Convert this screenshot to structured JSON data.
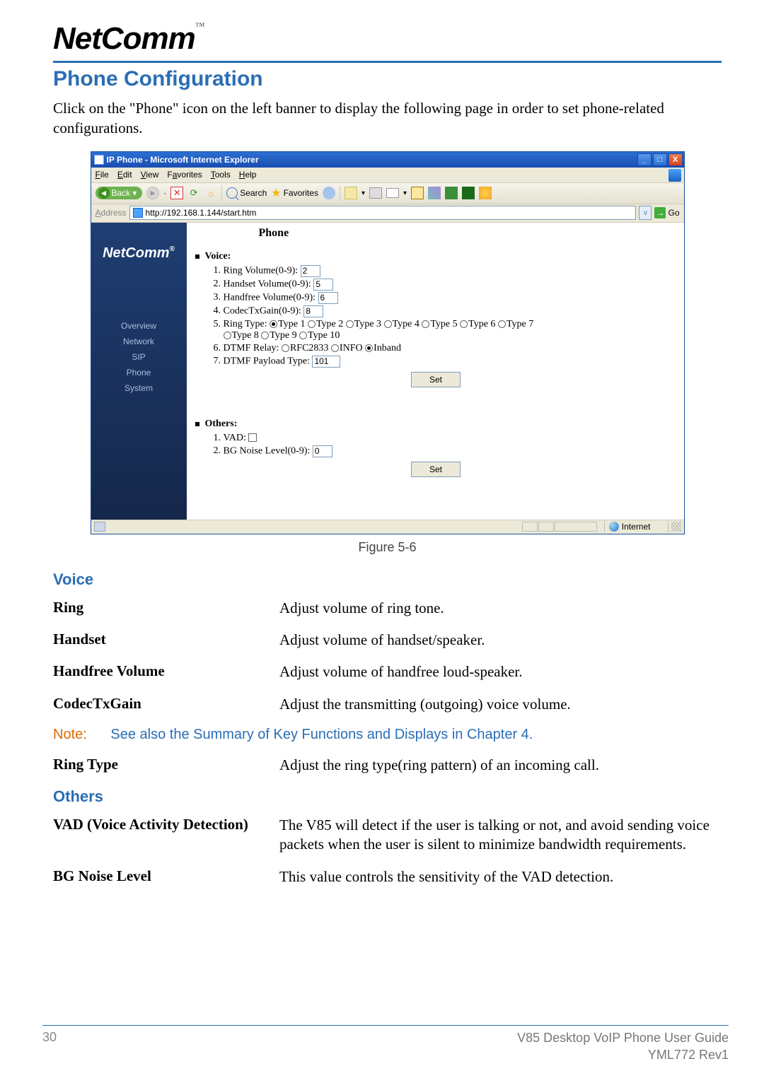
{
  "brand": {
    "name": "NetComm",
    "tm": "™",
    "reg": "®"
  },
  "headings": {
    "section": "Phone Configuration",
    "voice": "Voice",
    "others": "Others"
  },
  "intro": "Click on the \"Phone\" icon on the left banner to display the following page in order to set phone-related configurations.",
  "ie": {
    "title": "IP Phone - Microsoft Internet Explorer",
    "menus": {
      "file": "File",
      "edit": "Edit",
      "view": "View",
      "favorites": "Favorites",
      "tools": "Tools",
      "help": "Help"
    },
    "toolbar": {
      "back": "Back",
      "search": "Search",
      "favorites": "Favorites"
    },
    "address_label": "Address",
    "address_value": "http://192.168.1.144/start.htm",
    "go": "Go",
    "nav": {
      "overview": "Overview",
      "network": "Network",
      "sip": "SIP",
      "phone": "Phone",
      "system": "System"
    },
    "page_header": "Phone",
    "voice_section": "Voice:",
    "others_section": "Others:",
    "fields": {
      "ring_volume_label": "Ring Volume(0-9):",
      "ring_volume_value": "2",
      "handset_volume_label": "Handset Volume(0-9):",
      "handset_volume_value": "5",
      "handfree_volume_label": "Handfree Volume(0-9):",
      "handfree_volume_value": "6",
      "codectx_label": "CodecTxGain(0-9):",
      "codectx_value": "8",
      "ring_type_label": "Ring Type:",
      "ring_types": [
        "Type 1",
        "Type 2",
        "Type 3",
        "Type 4",
        "Type 5",
        "Type 6",
        "Type 7",
        "Type 8",
        "Type 9",
        "Type 10"
      ],
      "ring_type_selected": "Type 1",
      "dtmf_relay_label": "DTMF Relay:",
      "dtmf_relay_options": [
        "RFC2833",
        "INFO",
        "Inband"
      ],
      "dtmf_relay_selected": "Inband",
      "dtmf_payload_label": "DTMF Payload Type:",
      "dtmf_payload_value": "101",
      "vad_label": "VAD:",
      "bg_noise_label": "BG Noise Level(0-9):",
      "bg_noise_value": "0",
      "set_button": "Set"
    },
    "status_zone": "Internet"
  },
  "figure_caption": "Figure 5-6",
  "definitions": {
    "ring": {
      "term": "Ring",
      "desc": "Adjust volume of ring tone."
    },
    "handset": {
      "term": "Handset",
      "desc": "Adjust volume of handset/speaker."
    },
    "handfree": {
      "term": "Handfree Volume",
      "desc": "Adjust volume of handfree loud-speaker."
    },
    "codectx": {
      "term": "CodecTxGain",
      "desc": "Adjust the transmitting (outgoing) voice volume."
    },
    "ring_type": {
      "term": "Ring Type",
      "desc": "Adjust the ring type(ring pattern) of an incoming call."
    },
    "vad": {
      "term": "VAD (Voice Activity Detection)",
      "desc": "The V85 will detect if the user is talking or not, and avoid sending voice packets when the user is silent to minimize bandwidth requirements."
    },
    "bg_noise": {
      "term": "BG Noise Level",
      "desc": "This value controls the sensitivity of the VAD detection."
    }
  },
  "note": {
    "label": "Note:",
    "text": "See also the Summary of Key Functions and Displays in Chapter 4."
  },
  "footer": {
    "page": "30",
    "guide": "V85 Desktop VoIP Phone User Guide",
    "doc": "YML772 Rev1"
  }
}
